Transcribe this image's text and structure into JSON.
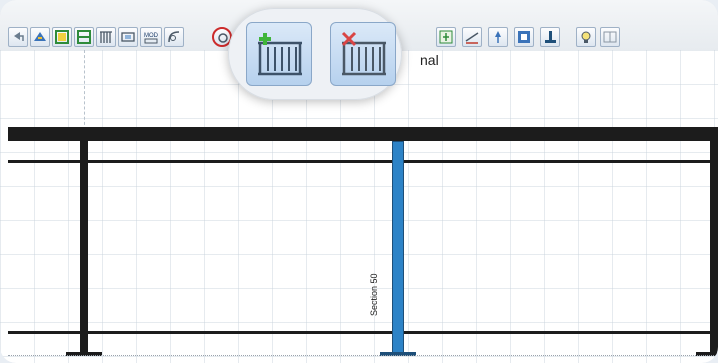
{
  "app": {
    "window_title_fragment": "nal"
  },
  "toolbar": {
    "tools": [
      {
        "name": "undo-icon"
      },
      {
        "name": "add-post-icon"
      },
      {
        "name": "panel-frame-icon"
      },
      {
        "name": "split-panel-icon"
      },
      {
        "name": "balusters-icon"
      },
      {
        "name": "infill-icon"
      },
      {
        "name": "mod-icon",
        "text": "MOD"
      },
      {
        "name": "curve-rail-icon"
      },
      {
        "name": "round-tool-icon"
      },
      {
        "name": "fit-icon"
      },
      {
        "name": "level-icon"
      },
      {
        "name": "pin-icon"
      },
      {
        "name": "center-icon"
      },
      {
        "name": "base-plate-icon"
      },
      {
        "name": "bulb-icon"
      },
      {
        "name": "grid-icon"
      }
    ],
    "magnified": [
      {
        "name": "add-railing-section-icon"
      },
      {
        "name": "delete-railing-section-icon"
      }
    ]
  },
  "drawing": {
    "section_label": "Section 50"
  },
  "colors": {
    "selected_post": "#2d83c7",
    "rail": "#1c1c1c",
    "add_accent": "#3fb53a",
    "delete_accent": "#d94545",
    "highlight_ring": "#cc2b2b"
  }
}
